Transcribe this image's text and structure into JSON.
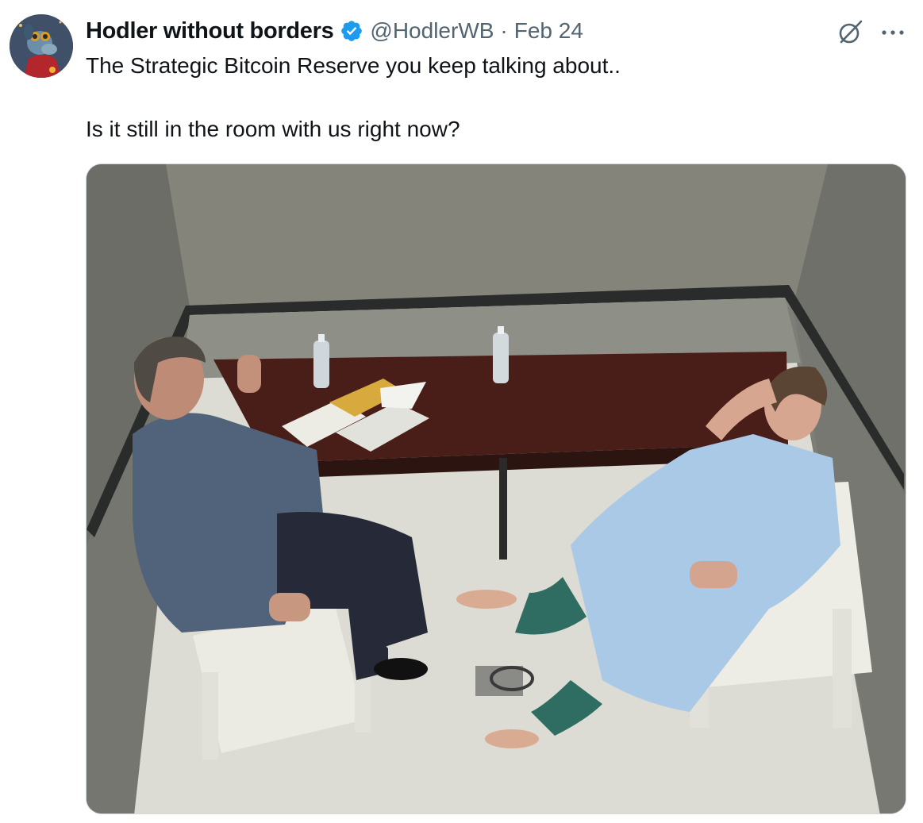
{
  "post": {
    "author_name": "Hodler without borders",
    "handle": "@HodlerWB",
    "separator": "·",
    "date": "Feb 24",
    "text_line1": "The Strategic Bitcoin Reserve you keep talking about..",
    "text_line2": "Is it still in the room with us right now?"
  },
  "icons": {
    "verified": "verified-badge-icon",
    "grok": "grok-icon",
    "more": "more-options-icon"
  },
  "colors": {
    "verified_blue": "#1d9bf0",
    "secondary_text": "#536471",
    "primary_text": "#0f1419"
  }
}
